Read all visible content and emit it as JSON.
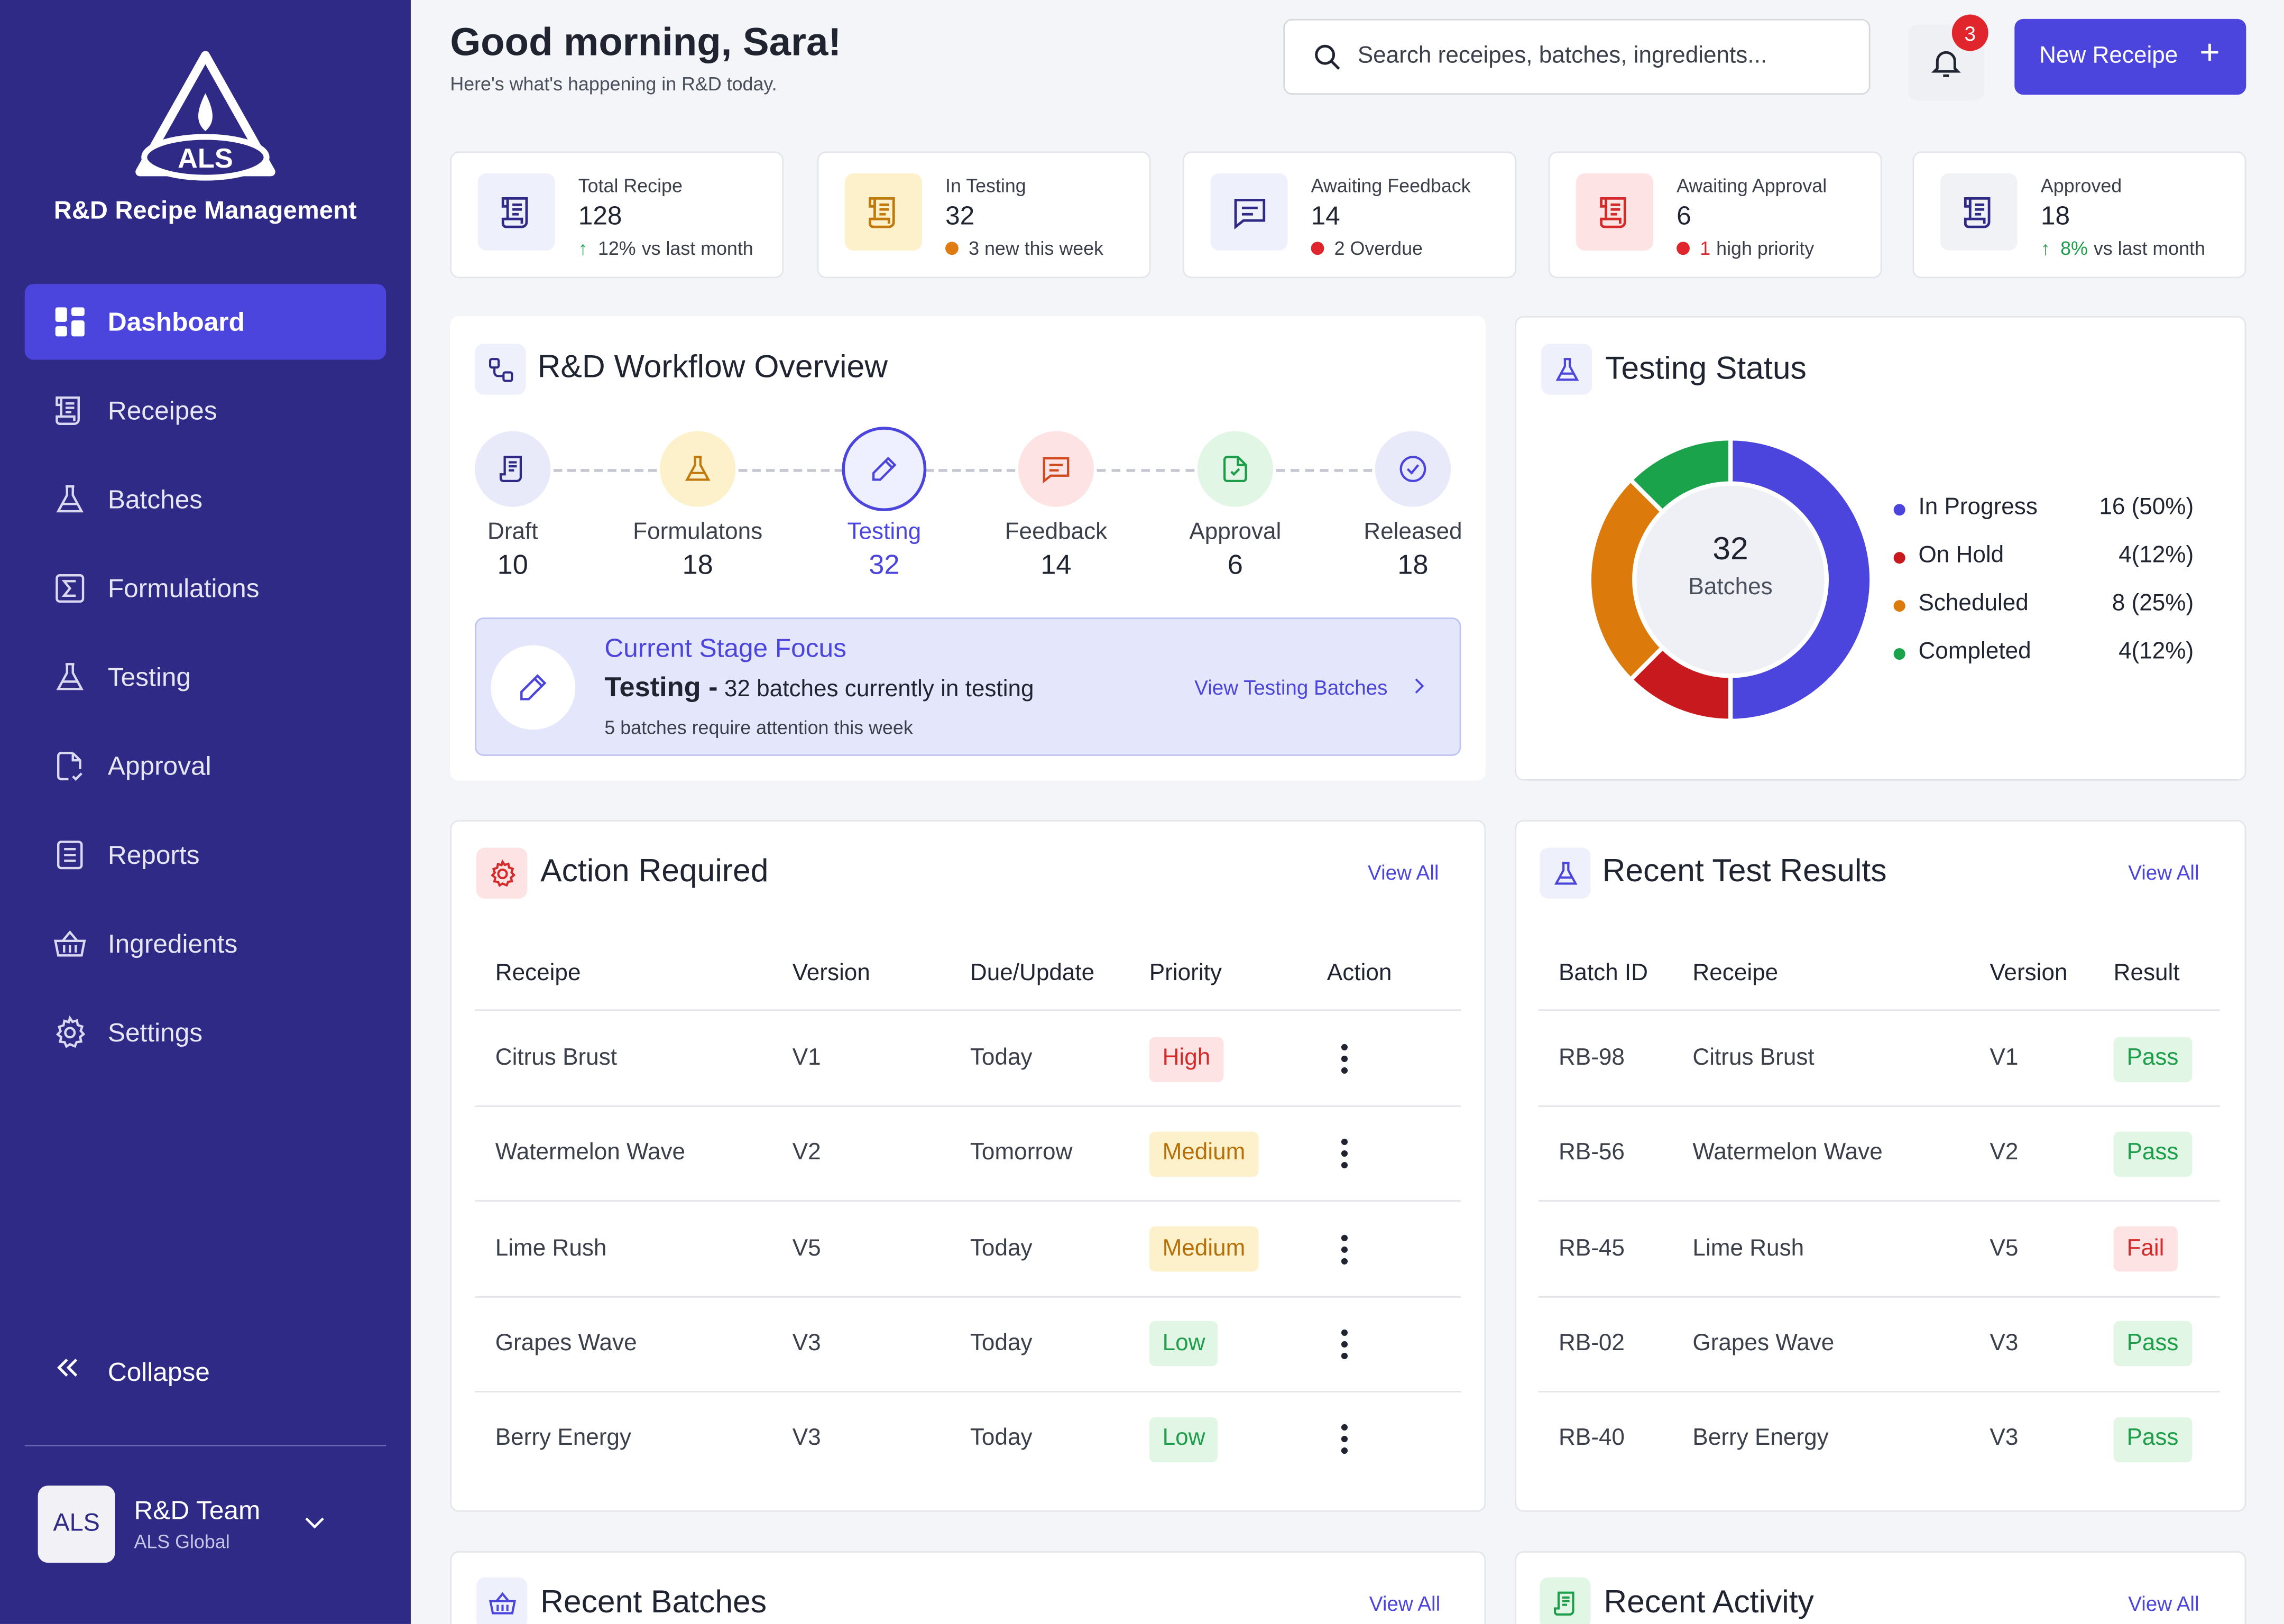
{
  "sidebar": {
    "brand": "R&D Recipe Management",
    "logo_text": "ALS",
    "items": [
      {
        "label": "Dashboard",
        "icon": "dashboard-icon",
        "active": true
      },
      {
        "label": "Receipes",
        "icon": "recipe-icon"
      },
      {
        "label": "Batches",
        "icon": "flask-icon"
      },
      {
        "label": "Formulations",
        "icon": "sigma-icon"
      },
      {
        "label": "Testing",
        "icon": "flask-icon"
      },
      {
        "label": "Approval",
        "icon": "document-check-icon"
      },
      {
        "label": "Reports",
        "icon": "report-icon"
      },
      {
        "label": "Ingredients",
        "icon": "basket-icon"
      },
      {
        "label": "Settings",
        "icon": "gear-icon"
      }
    ],
    "collapse_label": "Collapse",
    "team": {
      "avatar": "ALS",
      "name": "R&D Team",
      "org": "ALS Global"
    }
  },
  "header": {
    "greeting": "Good morning, Sara!",
    "subtitle": "Here's what's happening in R&D today.",
    "search_placeholder": "Search receipes, batches, ingredients...",
    "notification_count": "3",
    "new_button": "New Receipe"
  },
  "stats": [
    {
      "label": "Total Recipe",
      "value": "128",
      "sub_value": "12%",
      "sub_text": "vs last month",
      "indicator": "up",
      "icon_bg": "#eef0fb",
      "icon_color": "#2e2a86"
    },
    {
      "label": "In Testing",
      "value": "32",
      "sub_value": "",
      "sub_text": "3 new this week",
      "indicator": "dot",
      "dot_color": "#e07b12",
      "icon_bg": "#fdf1cc",
      "icon_color": "#c1780c"
    },
    {
      "label": "Awaiting Feedback",
      "value": "14",
      "sub_value": "",
      "sub_text": "2 Overdue",
      "indicator": "dot",
      "dot_color": "#e0262c",
      "icon_bg": "#eef0fb",
      "icon_color": "#2e2a86"
    },
    {
      "label": "Awaiting Approval",
      "value": "6",
      "sub_value": "1",
      "sub_text": "high priority",
      "indicator": "dot",
      "dot_color": "#e0262c",
      "icon_bg": "#fde3e3",
      "icon_color": "#d42a2a"
    },
    {
      "label": "Approved",
      "value": "18",
      "sub_value": "8%",
      "sub_text": "vs last month",
      "indicator": "up",
      "icon_bg": "#f1f2f5",
      "icon_color": "#2e2a86"
    }
  ],
  "workflow": {
    "title": "R&D Workflow Overview",
    "stages": [
      {
        "label": "Draft",
        "count": "10",
        "bg": "#e8eaf9",
        "color": "#2e2a86"
      },
      {
        "label": "Formulatons",
        "count": "18",
        "bg": "#fdf1cc",
        "color": "#c1780c"
      },
      {
        "label": "Testing",
        "count": "32",
        "bg": "#eef0ff",
        "color": "#4b45dd",
        "active": true
      },
      {
        "label": "Feedback",
        "count": "14",
        "bg": "#fde3e3",
        "color": "#d14a1e"
      },
      {
        "label": "Approval",
        "count": "6",
        "bg": "#e2f6e6",
        "color": "#1e9e4a"
      },
      {
        "label": "Released",
        "count": "18",
        "bg": "#e8eaf9",
        "color": "#4b45dd"
      }
    ],
    "focus": {
      "title": "Current Stage Focus",
      "stage": "Testing -",
      "detail": "32 batches currently in testing",
      "sub": "5 batches require attention this week",
      "link": "View Testing Batches"
    }
  },
  "testing_status": {
    "title": "Testing Status",
    "center_value": "32",
    "center_label": "Batches"
  },
  "chart_data": {
    "type": "pie",
    "categories": [
      "In Progress",
      "On Hold",
      "Scheduled",
      "Completed"
    ],
    "values": [
      16,
      4,
      8,
      4
    ],
    "labels": [
      "16 (50%)",
      "4(12%)",
      "8 (25%)",
      "4(12%)"
    ],
    "colors": [
      "#4b45dd",
      "#c8191f",
      "#dc7a0b",
      "#1aa34a"
    ],
    "legend": "right"
  },
  "action_required": {
    "title": "Action Required",
    "view_all": "View All",
    "headers": [
      "Receipe",
      "Version",
      "Due/Update",
      "Priority",
      "Action"
    ],
    "rows": [
      {
        "recipe": "Citrus Brust",
        "version": "V1",
        "due": "Today",
        "priority": "High"
      },
      {
        "recipe": "Watermelon Wave",
        "version": "V2",
        "due": "Tomorrow",
        "priority": "Medium"
      },
      {
        "recipe": "Lime Rush",
        "version": "V5",
        "due": "Today",
        "priority": "Medium"
      },
      {
        "recipe": "Grapes Wave",
        "version": "V3",
        "due": "Today",
        "priority": "Low"
      },
      {
        "recipe": "Berry Energy",
        "version": "V3",
        "due": "Today",
        "priority": "Low"
      }
    ],
    "priority_colors": {
      "High": {
        "bg": "#fde3e3",
        "fg": "#d42a2a"
      },
      "Medium": {
        "bg": "#fdf1cc",
        "fg": "#b5700a"
      },
      "Low": {
        "bg": "#e2f6e6",
        "fg": "#1e9e4a"
      }
    }
  },
  "recent_tests": {
    "title": "Recent Test Results",
    "view_all": "View All",
    "headers": [
      "Batch ID",
      "Receipe",
      "Version",
      "Result"
    ],
    "rows": [
      {
        "batch": "RB-98",
        "recipe": "Citrus Brust",
        "version": "V1",
        "result": "Pass"
      },
      {
        "batch": "RB-56",
        "recipe": "Watermelon Wave",
        "version": "V2",
        "result": "Pass"
      },
      {
        "batch": "RB-45",
        "recipe": "Lime Rush",
        "version": "V5",
        "result": "Fail"
      },
      {
        "batch": "RB-02",
        "recipe": "Grapes Wave",
        "version": "V3",
        "result": "Pass"
      },
      {
        "batch": "RB-40",
        "recipe": "Berry Energy",
        "version": "V3",
        "result": "Pass"
      }
    ],
    "result_colors": {
      "Pass": {
        "bg": "#e2f6e6",
        "fg": "#1e9e4a"
      },
      "Fail": {
        "bg": "#fde3e3",
        "fg": "#d42a2a"
      }
    }
  },
  "recent_batches": {
    "title": "Recent Batches",
    "view_all": "View All"
  },
  "recent_activity": {
    "title": "Recent Activity",
    "view_all": "View All"
  }
}
